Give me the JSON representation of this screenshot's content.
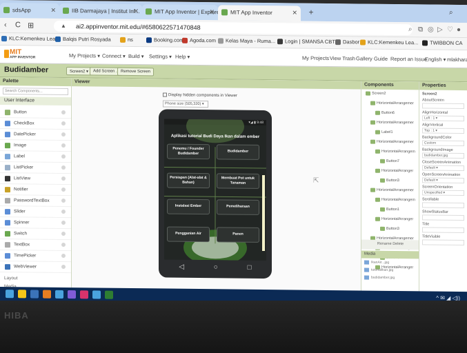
{
  "browser": {
    "tabs": [
      {
        "label": "sdsApp",
        "active": false
      },
      {
        "label": "IIB Darmajaya | Institut Inf...",
        "active": false
      },
      {
        "label": "MIT App Inventor | Explore",
        "active": false
      },
      {
        "label": "MIT App Inventor",
        "active": true
      }
    ],
    "new_tab": "+",
    "url": "ai2.appinventor.mit.edu/#6580622571470848",
    "bookmarks": [
      {
        "label": "KLC:Kemenkeu Lea...",
        "color": "#2d6db5"
      },
      {
        "label": "Balqis Putri Rosyada",
        "color": "#1f5fa8"
      },
      {
        "label": "ns",
        "color": "#e3a21a"
      },
      {
        "label": "Booking.com",
        "color": "#0a3a82"
      },
      {
        "label": "Agoda.com",
        "color": "#c0392b"
      },
      {
        "label": "Kelas Maya - Ruma...",
        "color": "#999999"
      },
      {
        "label": "Login | SMANSA CBT",
        "color": "#3a3a3a"
      },
      {
        "label": "Dasbor",
        "color": "#666666"
      },
      {
        "label": "KLC:Kemenkeu Lea...",
        "color": "#e3a21a"
      },
      {
        "label": "TWIBBON CA",
        "color": "#222222"
      }
    ]
  },
  "app": {
    "logo_text": "MIT",
    "logo_sub": "APP INVENTOR",
    "menus": [
      "My Projects ▾",
      "Connect ▾",
      "Build ▾",
      "Settings ▾",
      "Help ▾"
    ],
    "right_menus": [
      "My Projects",
      "View Trash",
      "Gallery",
      "Guide",
      "Report an Issue",
      "English ▾",
      "mlakhara"
    ],
    "project_name": "Budidamber",
    "project_buttons": [
      "Screen2 ▾",
      "Add Screen ...",
      "Remove Screen"
    ]
  },
  "palette": {
    "title": "Palette",
    "search_placeholder": "Search Components...",
    "category": "User Interface",
    "items": [
      {
        "label": "Button",
        "color": "#8fb46c"
      },
      {
        "label": "CheckBox",
        "color": "#5b8dd6"
      },
      {
        "label": "DatePicker",
        "color": "#5b8dd6"
      },
      {
        "label": "Image",
        "color": "#6aa84f"
      },
      {
        "label": "Label",
        "color": "#7aa6d8"
      },
      {
        "label": "ListPicker",
        "color": "#9ab0c8"
      },
      {
        "label": "ListView",
        "color": "#333333"
      },
      {
        "label": "Notifier",
        "color": "#c9a227"
      },
      {
        "label": "PasswordTextBox",
        "color": "#aaaaaa"
      },
      {
        "label": "Slider",
        "color": "#5b8dd6"
      },
      {
        "label": "Spinner",
        "color": "#5b8dd6"
      },
      {
        "label": "Switch",
        "color": "#6aa84f"
      },
      {
        "label": "TextBox",
        "color": "#aaaaaa"
      },
      {
        "label": "TimePicker",
        "color": "#5b8dd6"
      },
      {
        "label": "WebViewer",
        "color": "#3b73b9"
      }
    ],
    "footer": [
      "Layout",
      "Media"
    ]
  },
  "viewer": {
    "title": "Viewer",
    "hidden_checkbox": "Display hidden components in Viewer",
    "size_select": "Phone size (505,320) ▾",
    "status_time": "9:48",
    "app_title": "Aplikasi tutorial Budi Daya Ikan dalam ember",
    "buttons": [
      "Penemu / Founder Budidamber",
      "Budidamber",
      "Persiapan (Alat-alat & Bahan)",
      "Membuat Pot untuk Tanaman",
      "Instalasi Ember",
      "Pemeliharaan",
      "Pengganian Air",
      "Panen"
    ],
    "nav": [
      "◁",
      "○",
      "□"
    ]
  },
  "components": {
    "title": "Components",
    "tree": [
      {
        "label": "Screen2",
        "depth": 0
      },
      {
        "label": "HorizontalArrangemer",
        "depth": 1
      },
      {
        "label": "Button6",
        "depth": 2
      },
      {
        "label": "HorizontalArrangemer",
        "depth": 1
      },
      {
        "label": "Label1",
        "depth": 2
      },
      {
        "label": "HorizontalArrangemer",
        "depth": 1
      },
      {
        "label": "HorizontalArrangem",
        "depth": 2
      },
      {
        "label": "Button7",
        "depth": 3
      },
      {
        "label": "HorizontalArranger",
        "depth": 2
      },
      {
        "label": "Button3",
        "depth": 3
      },
      {
        "label": "HorizontalArrangemer",
        "depth": 1
      },
      {
        "label": "HorizontalArrangem",
        "depth": 2
      },
      {
        "label": "Button1",
        "depth": 3
      },
      {
        "label": "HorizontalArranger",
        "depth": 2
      },
      {
        "label": "Button3",
        "depth": 3
      },
      {
        "label": "HorizontalArrangemer",
        "depth": 1
      },
      {
        "label": "HorizontalArrangem",
        "depth": 2
      },
      {
        "label": "Button6",
        "depth": 3
      },
      {
        "label": "HorizontalArranger",
        "depth": 2
      }
    ],
    "rename_delete": "Rename   Delete",
    "media_title": "Media",
    "media": [
      "IkanAir...jpg",
      "tutorialikan.jpg",
      "budidamber.jpg"
    ]
  },
  "properties": {
    "title": "Properties",
    "screen": "Screen2",
    "items": [
      {
        "label": "AboutScreen",
        "value": ""
      },
      {
        "label": "AlignHorizontal",
        "value": "Left : 1 ▾"
      },
      {
        "label": "AlignVertical",
        "value": "Top : 1 ▾"
      },
      {
        "label": "BackgroundColor",
        "value": "Custom"
      },
      {
        "label": "BackgroundImage",
        "value": "budidamber.jpg"
      },
      {
        "label": "CloseScreenAnimation",
        "value": "Default ▾"
      },
      {
        "label": "OpenScreenAnimation",
        "value": "Default ▾"
      },
      {
        "label": "ScreenOrientation",
        "value": "Unspecified ▾"
      },
      {
        "label": "Scrollable",
        "value": ""
      },
      {
        "label": "ShowStatusBar",
        "value": ""
      },
      {
        "label": "Title",
        "value": ""
      },
      {
        "label": "TitleVisible",
        "value": ""
      }
    ]
  },
  "taskbar": {
    "tray": "^ ✉ ◢ ◁))",
    "icons": [
      "#4aa3df",
      "#f5c518",
      "#3b73b9",
      "#e67e22",
      "#4aa3df",
      "#7f5cd6",
      "#d6336c",
      "#4aa3df",
      "#2e7d32"
    ]
  },
  "bezel": {
    "brand": "HIBA"
  }
}
